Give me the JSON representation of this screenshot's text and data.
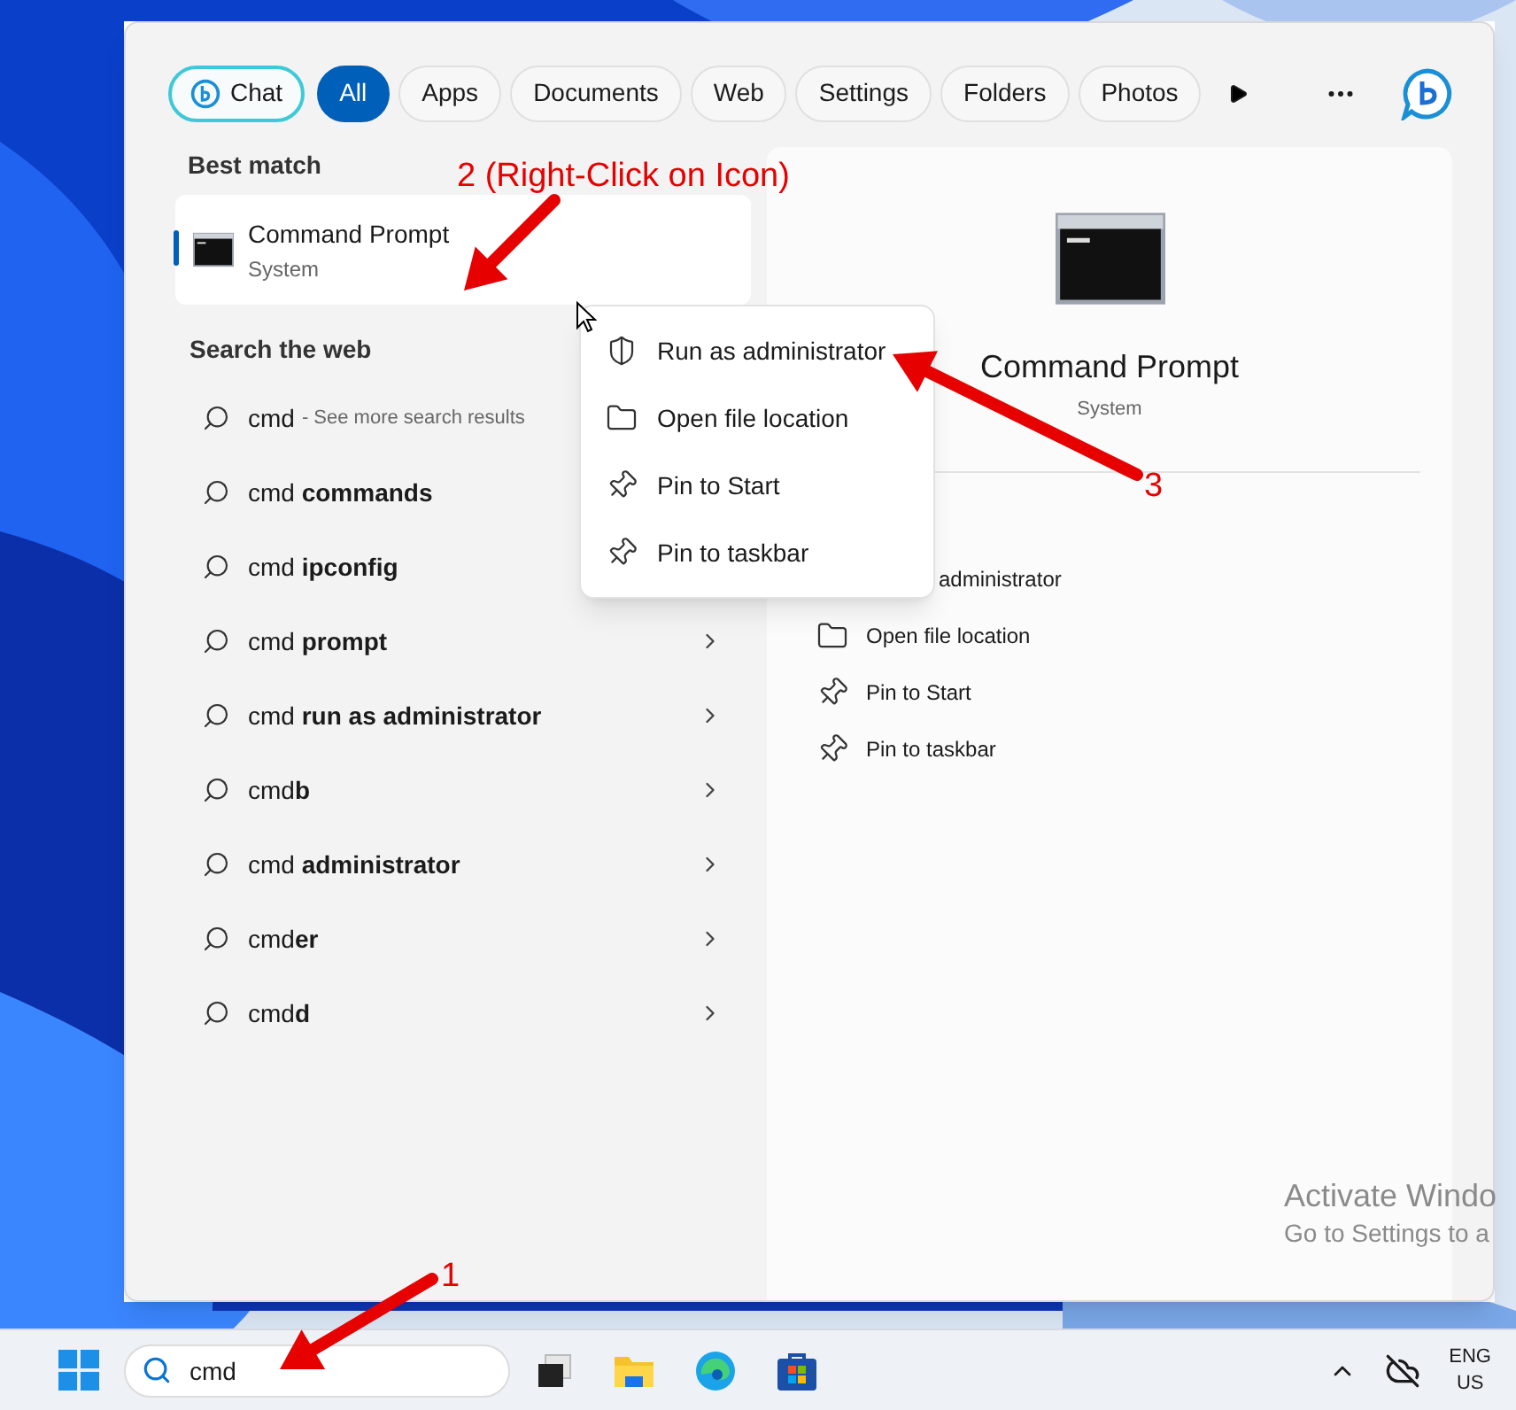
{
  "filters": [
    {
      "label": "Chat",
      "kind": "chat",
      "selected": false
    },
    {
      "label": "All",
      "kind": "tab",
      "selected": true
    },
    {
      "label": "Apps",
      "kind": "tab",
      "selected": false
    },
    {
      "label": "Documents",
      "kind": "tab",
      "selected": false
    },
    {
      "label": "Web",
      "kind": "tab",
      "selected": false
    },
    {
      "label": "Settings",
      "kind": "tab",
      "selected": false
    },
    {
      "label": "Folders",
      "kind": "tab",
      "selected": false
    },
    {
      "label": "Photos",
      "kind": "tab",
      "selected": false
    }
  ],
  "best_match": {
    "heading": "Best match",
    "title": "Command Prompt",
    "subtitle": "System",
    "selected": true
  },
  "web": {
    "heading": "Search the web",
    "rows": [
      {
        "kind": "more",
        "text": "cmd",
        "note": "- See more search results"
      },
      {
        "kind": "suggestion",
        "text": "cmd **commands**"
      },
      {
        "kind": "suggestion",
        "text": "cmd **ipconfig**"
      },
      {
        "kind": "suggestion",
        "text": "cmd **prompt**",
        "chevron": true
      },
      {
        "kind": "suggestion",
        "text": "cmd **run as administrator**",
        "chevron": true
      },
      {
        "kind": "suggestion",
        "text": "cmd**b**",
        "chevron": true
      },
      {
        "kind": "suggestion",
        "text": "cmd **administrator**",
        "chevron": true
      },
      {
        "kind": "suggestion",
        "text": "cmd**er**",
        "chevron": true
      },
      {
        "kind": "suggestion",
        "text": "cmd**d**",
        "chevron": true
      }
    ]
  },
  "details": {
    "title": "Command Prompt",
    "subtitle": "System",
    "actions": [
      {
        "kind": "partial",
        "label": "administrator"
      },
      {
        "kind": "folder",
        "label": "Open file location"
      },
      {
        "kind": "pin",
        "label": "Pin to Start"
      },
      {
        "kind": "pin",
        "label": "Pin to taskbar"
      }
    ]
  },
  "context_menu": {
    "items": [
      {
        "kind": "shield",
        "label": "Run as administrator"
      },
      {
        "kind": "folder",
        "label": "Open file location"
      },
      {
        "kind": "pin",
        "label": "Pin to Start"
      },
      {
        "kind": "pin",
        "label": "Pin to taskbar"
      }
    ]
  },
  "annotations": [
    {
      "label": "2 (Right-Click on Icon)"
    },
    {
      "label": "3"
    },
    {
      "label": "1"
    }
  ],
  "watermark": {
    "title": "Activate Windo",
    "subtitle": "Go to Settings to a"
  },
  "taskbar": {
    "search": {
      "value": "cmd"
    },
    "language": "ENG",
    "region": "US"
  }
}
